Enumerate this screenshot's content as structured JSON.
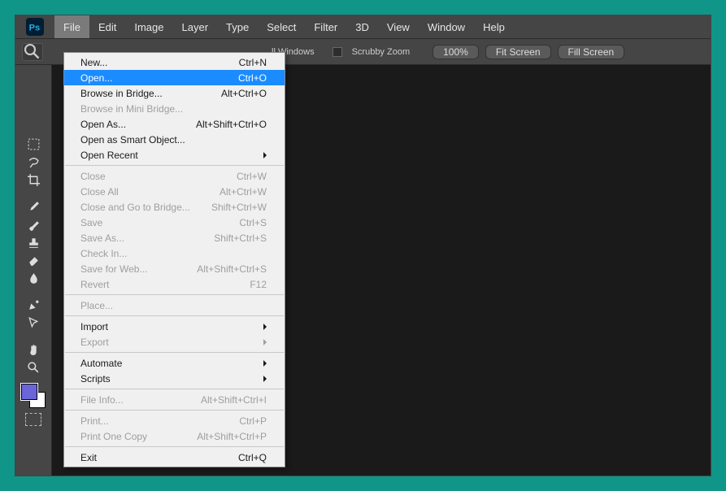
{
  "menubar": {
    "items": [
      "File",
      "Edit",
      "Image",
      "Layer",
      "Type",
      "Select",
      "Filter",
      "3D",
      "View",
      "Window",
      "Help"
    ],
    "active_index": 0
  },
  "options_bar": {
    "label_windows": "ll Windows",
    "label_scrubby": "Scrubby Zoom",
    "zoom_value": "100%",
    "btn_fit": "Fit Screen",
    "btn_fill": "Fill Screen"
  },
  "file_menu": [
    {
      "label": "New...",
      "shortcut": "Ctrl+N"
    },
    {
      "label": "Open...",
      "shortcut": "Ctrl+O",
      "highlight": true
    },
    {
      "label": "Browse in Bridge...",
      "shortcut": "Alt+Ctrl+O"
    },
    {
      "label": "Browse in Mini Bridge...",
      "disabled": true
    },
    {
      "label": "Open As...",
      "shortcut": "Alt+Shift+Ctrl+O"
    },
    {
      "label": "Open as Smart Object..."
    },
    {
      "label": "Open Recent",
      "submenu": true
    },
    {
      "sep": true
    },
    {
      "label": "Close",
      "shortcut": "Ctrl+W",
      "disabled": true
    },
    {
      "label": "Close All",
      "shortcut": "Alt+Ctrl+W",
      "disabled": true
    },
    {
      "label": "Close and Go to Bridge...",
      "shortcut": "Shift+Ctrl+W",
      "disabled": true
    },
    {
      "label": "Save",
      "shortcut": "Ctrl+S",
      "disabled": true
    },
    {
      "label": "Save As...",
      "shortcut": "Shift+Ctrl+S",
      "disabled": true
    },
    {
      "label": "Check In...",
      "disabled": true
    },
    {
      "label": "Save for Web...",
      "shortcut": "Alt+Shift+Ctrl+S",
      "disabled": true
    },
    {
      "label": "Revert",
      "shortcut": "F12",
      "disabled": true
    },
    {
      "sep": true
    },
    {
      "label": "Place...",
      "disabled": true
    },
    {
      "sep": true
    },
    {
      "label": "Import",
      "submenu": true
    },
    {
      "label": "Export",
      "submenu": true,
      "disabled": true
    },
    {
      "sep": true
    },
    {
      "label": "Automate",
      "submenu": true
    },
    {
      "label": "Scripts",
      "submenu": true
    },
    {
      "sep": true
    },
    {
      "label": "File Info...",
      "shortcut": "Alt+Shift+Ctrl+I",
      "disabled": true
    },
    {
      "sep": true
    },
    {
      "label": "Print...",
      "shortcut": "Ctrl+P",
      "disabled": true
    },
    {
      "label": "Print One Copy",
      "shortcut": "Alt+Shift+Ctrl+P",
      "disabled": true
    },
    {
      "sep": true
    },
    {
      "label": "Exit",
      "shortcut": "Ctrl+Q"
    }
  ],
  "tools": [
    "marquee",
    "lasso",
    "crop",
    "eyedropper",
    "brush",
    "stamp",
    "eraser",
    "blur",
    "pen",
    "direct-select",
    "hand",
    "zoom"
  ]
}
